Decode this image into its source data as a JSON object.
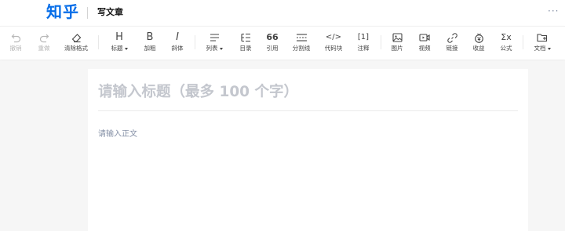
{
  "header": {
    "logo_text": "知乎",
    "page_title": "写文章",
    "more": "···"
  },
  "toolbar": {
    "items": [
      {
        "label": "撤销",
        "icon": "undo-icon",
        "disabled": true
      },
      {
        "label": "重做",
        "icon": "redo-icon",
        "disabled": true
      },
      {
        "label": "清除格式",
        "icon": "eraser-icon",
        "disabled": false
      },
      {
        "label": "标题",
        "icon": "heading-icon",
        "glyph": "H",
        "dropdown": true
      },
      {
        "label": "加粗",
        "icon": "bold-icon",
        "glyph": "B"
      },
      {
        "label": "斜体",
        "icon": "italic-icon",
        "glyph": "I"
      },
      {
        "label": "列表",
        "icon": "list-icon",
        "dropdown": true
      },
      {
        "label": "目录",
        "icon": "toc-icon"
      },
      {
        "label": "引用",
        "icon": "quote-icon",
        "glyph": "66"
      },
      {
        "label": "分割线",
        "icon": "divider-icon"
      },
      {
        "label": "代码块",
        "icon": "code-icon",
        "glyph": "</>"
      },
      {
        "label": "注释",
        "icon": "annotation-icon",
        "glyph": "[1]"
      },
      {
        "label": "图片",
        "icon": "image-icon"
      },
      {
        "label": "视频",
        "icon": "video-icon"
      },
      {
        "label": "链接",
        "icon": "link-icon"
      },
      {
        "label": "收益",
        "icon": "earnings-icon"
      },
      {
        "label": "公式",
        "icon": "formula-icon",
        "glyph": "Σx"
      },
      {
        "label": "文档",
        "icon": "document-icon",
        "dropdown": true
      }
    ]
  },
  "editor": {
    "title_placeholder": "请输入标题（最多 100 个字）",
    "body_placeholder": "请输入正文"
  },
  "colors": {
    "brand": "#056de8",
    "background": "#f6f6f6",
    "placeholder_title": "#c4c7ce",
    "placeholder_body": "#8590a6"
  }
}
